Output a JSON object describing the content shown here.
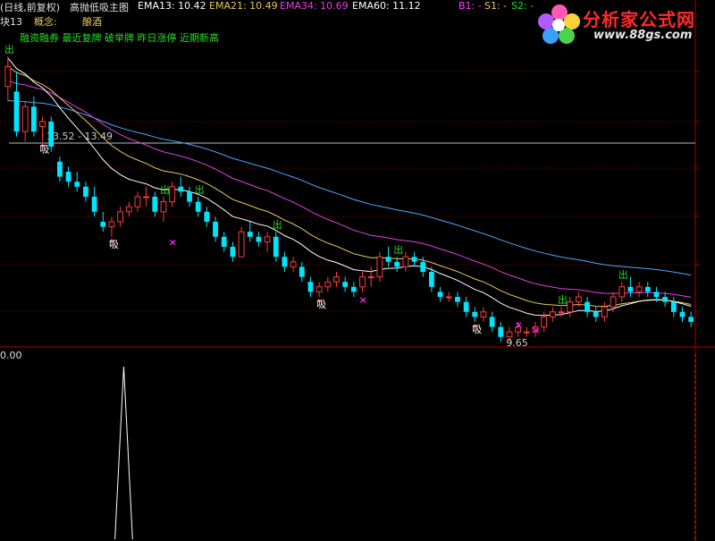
{
  "header": {
    "period": "(日线,前复权)",
    "indicator_name": "高抛低吸主图",
    "ema13": "EMA13: 10.42",
    "ema21": "EMA21: 10.49",
    "ema34": "EMA34: 10.69",
    "ema60": "EMA60: 11.12",
    "b1": "B1: -",
    "s1": "S1: -",
    "s2": "S2: -"
  },
  "info": {
    "block_label": "块13",
    "concept_label": "概念:",
    "concept_value": "酿酒",
    "tags": "融资融券 最近复牌 破举牌 昨日涨停 近期新高"
  },
  "chart": {
    "price_line_label": "13.52 - 13.49",
    "low_label": "9.65",
    "signal_buy": "吸",
    "signal_sell": "出",
    "sub_value": "0.00"
  },
  "watermark": {
    "text1": "分析家公式网",
    "text2": "www.88gs.com"
  },
  "colors": {
    "up": "#ff3b3b",
    "down": "#00e5ff",
    "ema13": "#ffffff",
    "ema21": "#e6c85a",
    "ema34": "#e040e0",
    "ema60": "#4aa8ff",
    "grid": "#8b0000",
    "signal_sell": "#22dd22",
    "signal_cross": "#ff22ff"
  },
  "chart_data": {
    "type": "candlestick",
    "candles": [
      [
        14.2,
        14.8,
        13.9,
        14.6
      ],
      [
        14.1,
        14.5,
        13.2,
        13.3
      ],
      [
        13.3,
        13.9,
        13.1,
        13.8
      ],
      [
        13.8,
        14.0,
        13.2,
        13.3
      ],
      [
        13.4,
        13.6,
        13.1,
        13.5
      ],
      [
        13.5,
        13.6,
        12.9,
        13.0
      ],
      [
        12.7,
        12.8,
        12.3,
        12.4
      ],
      [
        12.5,
        12.6,
        12.2,
        12.3
      ],
      [
        12.3,
        12.5,
        12.1,
        12.2
      ],
      [
        12.2,
        12.3,
        11.9,
        12.0
      ],
      [
        12.0,
        12.2,
        11.6,
        11.7
      ],
      [
        11.5,
        11.7,
        11.3,
        11.4
      ],
      [
        11.4,
        11.6,
        11.2,
        11.5
      ],
      [
        11.5,
        11.8,
        11.4,
        11.7
      ],
      [
        11.7,
        11.9,
        11.6,
        11.8
      ],
      [
        11.8,
        12.1,
        11.7,
        12.0
      ],
      [
        12.0,
        12.2,
        11.8,
        12.0
      ],
      [
        12.0,
        12.1,
        11.6,
        11.7
      ],
      [
        11.7,
        12.0,
        11.5,
        11.9
      ],
      [
        11.9,
        12.3,
        11.8,
        12.2
      ],
      [
        12.2,
        12.4,
        12.0,
        12.1
      ],
      [
        12.1,
        12.2,
        11.8,
        11.9
      ],
      [
        11.9,
        12.0,
        11.6,
        11.7
      ],
      [
        11.7,
        11.8,
        11.4,
        11.5
      ],
      [
        11.5,
        11.6,
        11.1,
        11.2
      ],
      [
        11.2,
        11.3,
        10.9,
        11.0
      ],
      [
        11.0,
        11.1,
        10.7,
        10.8
      ],
      [
        10.8,
        11.4,
        10.8,
        11.3
      ],
      [
        11.3,
        11.5,
        11.1,
        11.2
      ],
      [
        11.2,
        11.3,
        11.0,
        11.1
      ],
      [
        11.1,
        11.3,
        10.9,
        11.2
      ],
      [
        11.2,
        11.3,
        10.7,
        10.8
      ],
      [
        10.8,
        10.9,
        10.5,
        10.6
      ],
      [
        10.6,
        10.8,
        10.5,
        10.7
      ],
      [
        10.6,
        10.7,
        10.3,
        10.4
      ],
      [
        10.3,
        10.4,
        10.0,
        10.1
      ],
      [
        10.1,
        10.3,
        10.0,
        10.2
      ],
      [
        10.2,
        10.4,
        10.1,
        10.3
      ],
      [
        10.3,
        10.5,
        10.2,
        10.4
      ],
      [
        10.3,
        10.4,
        10.1,
        10.2
      ],
      [
        10.2,
        10.3,
        10.0,
        10.1
      ],
      [
        10.2,
        10.5,
        10.1,
        10.4
      ],
      [
        10.4,
        10.6,
        10.2,
        10.4
      ],
      [
        10.4,
        10.9,
        10.3,
        10.8
      ],
      [
        10.8,
        11.0,
        10.6,
        10.7
      ],
      [
        10.7,
        10.8,
        10.5,
        10.6
      ],
      [
        10.6,
        10.9,
        10.5,
        10.8
      ],
      [
        10.8,
        10.9,
        10.6,
        10.7
      ],
      [
        10.7,
        10.8,
        10.4,
        10.5
      ],
      [
        10.5,
        10.6,
        10.1,
        10.2
      ],
      [
        10.1,
        10.2,
        9.9,
        10.0
      ],
      [
        10.0,
        10.1,
        9.9,
        10.0
      ],
      [
        10.0,
        10.1,
        9.8,
        9.9
      ],
      [
        9.9,
        10.0,
        9.6,
        9.7
      ],
      [
        9.7,
        9.8,
        9.5,
        9.6
      ],
      [
        9.6,
        9.8,
        9.5,
        9.7
      ],
      [
        9.6,
        9.7,
        9.3,
        9.4
      ],
      [
        9.4,
        9.5,
        9.1,
        9.2
      ],
      [
        9.2,
        9.4,
        9.1,
        9.3
      ],
      [
        9.3,
        9.5,
        9.2,
        9.4
      ],
      [
        9.3,
        9.4,
        9.2,
        9.3
      ],
      [
        9.3,
        9.5,
        9.2,
        9.4
      ],
      [
        9.4,
        9.7,
        9.3,
        9.6
      ],
      [
        9.6,
        9.8,
        9.5,
        9.7
      ],
      [
        9.7,
        9.8,
        9.6,
        9.7
      ],
      [
        9.7,
        10.0,
        9.6,
        9.9
      ],
      [
        9.9,
        10.1,
        9.8,
        10.0
      ],
      [
        9.9,
        10.0,
        9.6,
        9.7
      ],
      [
        9.7,
        9.8,
        9.5,
        9.6
      ],
      [
        9.6,
        9.9,
        9.5,
        9.8
      ],
      [
        9.8,
        10.1,
        9.7,
        10.0
      ],
      [
        10.0,
        10.3,
        9.9,
        10.2
      ],
      [
        10.2,
        10.4,
        10.0,
        10.1
      ],
      [
        10.1,
        10.3,
        10.0,
        10.2
      ],
      [
        10.2,
        10.3,
        10.0,
        10.1
      ],
      [
        10.1,
        10.2,
        9.9,
        10.0
      ],
      [
        10.0,
        10.1,
        9.8,
        9.9
      ],
      [
        9.9,
        10.0,
        9.6,
        9.7
      ],
      [
        9.7,
        9.8,
        9.5,
        9.6
      ],
      [
        9.6,
        9.7,
        9.4,
        9.5
      ]
    ],
    "buy_signal_bars": [
      4,
      12,
      36,
      54
    ],
    "sell_signal_bars": [
      0,
      18,
      22,
      31,
      45,
      64,
      71
    ],
    "cross_marks": [
      [
        19,
        11.1
      ],
      [
        41,
        9.95
      ],
      [
        59,
        9.45
      ],
      [
        61,
        9.35
      ]
    ],
    "sub_spike_bar": [
      13,
      14
    ]
  }
}
